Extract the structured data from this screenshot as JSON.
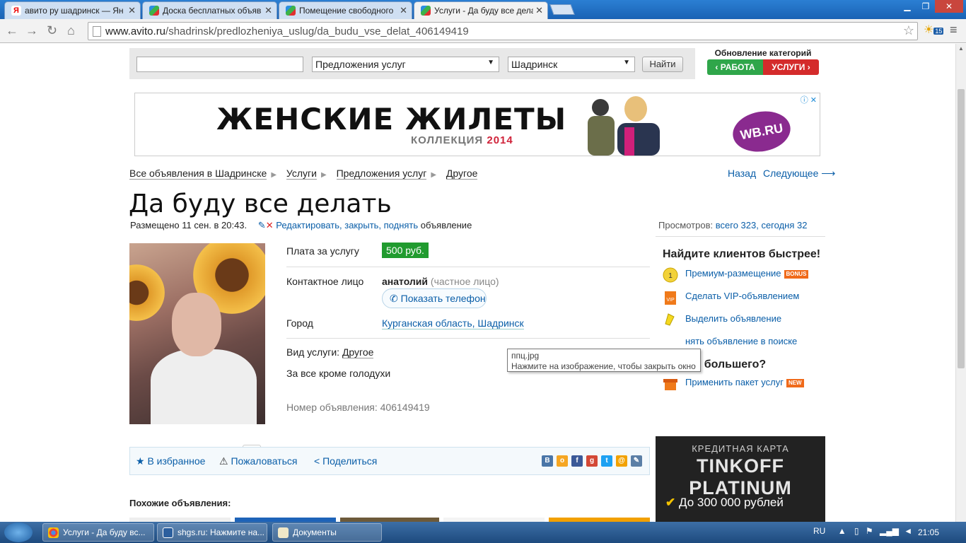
{
  "browser": {
    "tabs": [
      {
        "label": "авито ру шадринск — Ян",
        "icon": "yandex-icon"
      },
      {
        "label": "Доска бесплатных объяв",
        "icon": "avito-icon"
      },
      {
        "label": "Помещение свободного",
        "icon": "avito-icon"
      },
      {
        "label": "Услуги - Да буду все дела",
        "icon": "avito-icon",
        "active": true
      }
    ],
    "url_host": "www.avito.ru",
    "url_path": "/shadrinsk/predlozheniya_uslug/da_budu_vse_delat_406149419",
    "extension_badge": "15"
  },
  "search": {
    "category": "Предложения услуг",
    "city": "Шадринск",
    "button": "Найти"
  },
  "category_update": {
    "title": "Обновление категорий",
    "work": "‹ РАБОТА",
    "services": "УСЛУГИ ›"
  },
  "banner": {
    "headline": "ЖЕНСКИЕ ЖИЛЕТЫ",
    "sub": "КОЛЛЕКЦИЯ",
    "year": "2014",
    "brand": "WB.RU"
  },
  "breadcrumbs": [
    "Все объявления в Шадринске",
    "Услуги",
    "Предложения услуг",
    "Другое"
  ],
  "nav": {
    "back": "Назад",
    "next": "Следующее ⟶"
  },
  "ad": {
    "title": "Да буду все делать",
    "posted": "Размещено 11 сен. в 20:43.",
    "edit_link": "Редактировать, закрыть, поднять",
    "edit_suffix": "объявление",
    "views_label": "Просмотров:",
    "views_value": "всего 323, сегодня 32",
    "price_label": "Плата за услугу",
    "price": "500 руб.",
    "contact_label": "Контактное лицо",
    "contact_name": "анатолий",
    "contact_type": "(частное лицо)",
    "show_phone": "Показать телефон",
    "city_label": "Город",
    "city_value": "Курганская область, Шадринск",
    "service_label": "Вид услуги:",
    "service_value": "Другое",
    "description": "За все кроме голодухи",
    "ad_number": "Номер объявления: 406149419"
  },
  "tooltip": {
    "line1": "ппц.jpg",
    "line2": "Нажмите на изображение, чтобы закрыть окно"
  },
  "promo": {
    "title": "Найдите клиентов быстрее!",
    "items": [
      "Премиум-размещение",
      "Сделать VIP-объявлением",
      "Выделить объявление",
      "нять объявление в поиске"
    ],
    "bonus_badge": "BONUS",
    "more_title": "Хотите большего?",
    "package": "Применить пакет услуг",
    "new_badge": "NEW"
  },
  "share": {
    "favorite": "В избранное",
    "complain": "Пожаловаться",
    "share": "Поделиться"
  },
  "similar_title": "Похожие объявления:",
  "tinkoff": {
    "line1": "КРЕДИТНАЯ КАРТА",
    "line2": "TINKOFF PLATINUM",
    "line3": "До 300 000 рублей"
  },
  "taskbar": {
    "items": [
      "Услуги - Да буду вс...",
      "shgs.ru: Нажмите на...",
      "Документы"
    ],
    "lang": "RU",
    "time": "21:05"
  }
}
